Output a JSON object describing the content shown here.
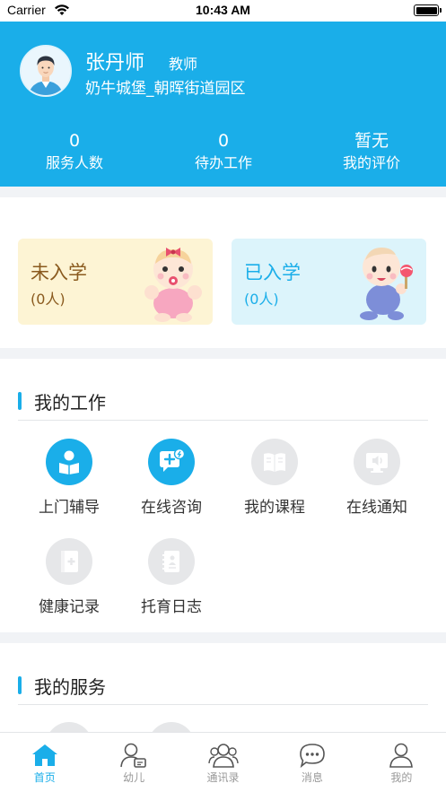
{
  "status_bar": {
    "carrier": "Carrier",
    "time": "10:43 AM"
  },
  "profile": {
    "name": "张丹师",
    "role": "教师",
    "campus": "奶牛城堡_朝晖街道园区"
  },
  "stats": [
    {
      "value": "0",
      "label": "服务人数"
    },
    {
      "value": "0",
      "label": "待办工作"
    },
    {
      "value": "暂无",
      "label": "我的评价"
    }
  ],
  "enrollment": {
    "not_enrolled": {
      "title": "未入学",
      "count": "(0人)"
    },
    "enrolled": {
      "title": "已入学",
      "count": "(0人)"
    }
  },
  "my_work": {
    "title": "我的工作",
    "items": [
      {
        "label": "上门辅导",
        "icon": "reading-person-icon",
        "enabled": true
      },
      {
        "label": "在线咨询",
        "icon": "chat-plus-icon",
        "enabled": true
      },
      {
        "label": "我的课程",
        "icon": "book-icon",
        "enabled": false
      },
      {
        "label": "在线通知",
        "icon": "monitor-speaker-icon",
        "enabled": false
      },
      {
        "label": "健康记录",
        "icon": "medical-book-icon",
        "enabled": false
      },
      {
        "label": "托育日志",
        "icon": "journal-icon",
        "enabled": false
      }
    ]
  },
  "my_services": {
    "title": "我的服务"
  },
  "tabbar": {
    "tabs": [
      {
        "label": "首页",
        "icon": "home-icon",
        "active": true
      },
      {
        "label": "幼儿",
        "icon": "child-profile-icon",
        "active": false
      },
      {
        "label": "通讯录",
        "icon": "contacts-icon",
        "active": false
      },
      {
        "label": "消息",
        "icon": "message-icon",
        "active": false
      },
      {
        "label": "我的",
        "icon": "me-icon",
        "active": false
      }
    ]
  },
  "colors": {
    "primary": "#1aaee9",
    "not_enrolled_bg": "#fdf4d4",
    "not_enrolled_text": "#8a5a1e",
    "enrolled_bg": "#dcf4fb",
    "enrolled_text": "#1aaee9",
    "inactive_icon_bg": "#e6e7e9"
  }
}
